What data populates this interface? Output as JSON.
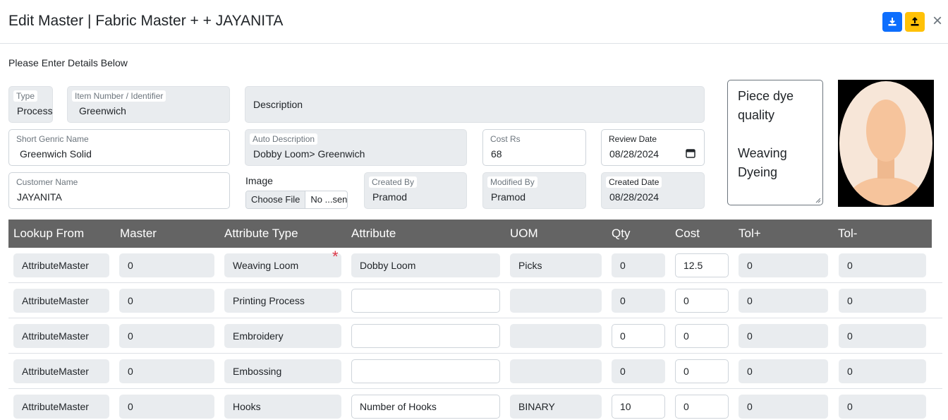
{
  "header": {
    "title": "Edit Master | Fabric Master + + JAYANITA",
    "download_icon": "download-icon",
    "upload_icon": "upload-icon",
    "close_icon": "close-icon",
    "close_glyph": "×"
  },
  "subtitle": "Please Enter Details Below",
  "form": {
    "type": {
      "label": "Type",
      "value": "Process"
    },
    "item_number": {
      "label": "Item Number / Identifier",
      "value": "Greenwich"
    },
    "description": {
      "label": "Description",
      "value": ""
    },
    "short_name": {
      "label": "Short Genric Name",
      "value": "Greenwich Solid"
    },
    "auto_description": {
      "label": "Auto Description",
      "value": "Dobby Loom> Greenwich"
    },
    "cost": {
      "label": "Cost Rs",
      "value": "68"
    },
    "review_date": {
      "label": "Review Date",
      "value": "08/28/2024"
    },
    "customer_name": {
      "label": "Customer Name",
      "value": "JAYANITA"
    },
    "image": {
      "label": "Image",
      "button": "Choose File",
      "filename": "No ...sen"
    },
    "created_by": {
      "label": "Created By",
      "value": "Pramod"
    },
    "modified_by": {
      "label": "Modified By",
      "value": "Pramod"
    },
    "created_date": {
      "label": "Created Date",
      "value": "08/28/2024"
    }
  },
  "notes": {
    "lines": [
      "Piece dye",
      "quality",
      "",
      "Weaving",
      "Dyeing"
    ]
  },
  "avatar": {
    "icon": "avatar-placeholder-icon"
  },
  "table": {
    "headers": [
      "Lookup From",
      "Master",
      "Attribute Type",
      "Attribute",
      "UOM",
      "Qty",
      "Cost",
      "Tol+",
      "Tol-"
    ],
    "rows": [
      {
        "lookup": "AttributeMaster",
        "master": "0",
        "attr_type": "Weaving Loom",
        "attribute": "Dobby Loom",
        "uom": "Picks",
        "qty": "0",
        "cost": "12.5",
        "tol_plus": "0",
        "tol_minus": "0",
        "required": "*"
      },
      {
        "lookup": "AttributeMaster",
        "master": "0",
        "attr_type": "Printing Process",
        "attribute": "",
        "uom": "",
        "qty": "0",
        "cost": "0",
        "tol_plus": "0",
        "tol_minus": "0"
      },
      {
        "lookup": "AttributeMaster",
        "master": "0",
        "attr_type": "Embroidery",
        "attribute": "",
        "uom": "",
        "qty": "0",
        "cost": "0",
        "tol_plus": "0",
        "tol_minus": "0"
      },
      {
        "lookup": "AttributeMaster",
        "master": "0",
        "attr_type": "Embossing",
        "attribute": "",
        "uom": "",
        "qty": "0",
        "cost": "0",
        "tol_plus": "0",
        "tol_minus": "0"
      },
      {
        "lookup": "AttributeMaster",
        "master": "0",
        "attr_type": "Hooks",
        "attribute": "Number of Hooks",
        "uom": "BINARY",
        "qty": "10",
        "cost": "0",
        "tol_plus": "0",
        "tol_minus": "0"
      }
    ]
  },
  "colors": {
    "primary": "#0d6efd",
    "warning": "#ffc107",
    "table_header": "#646464",
    "required": "#dc3545"
  }
}
